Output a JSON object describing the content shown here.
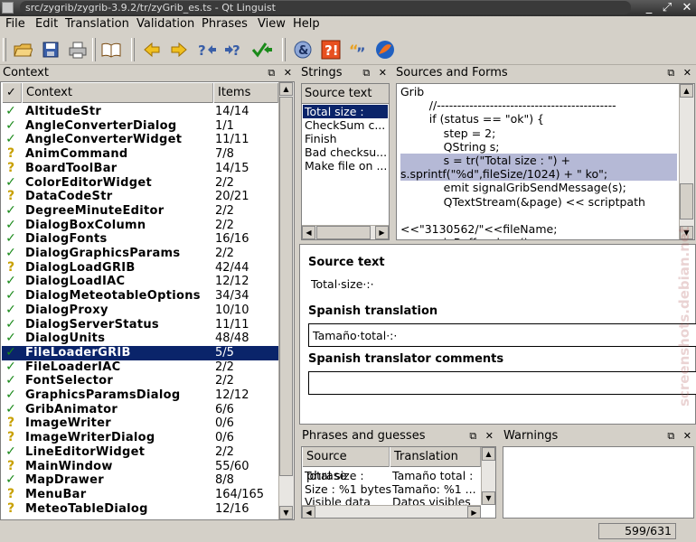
{
  "window": {
    "title": "src/zygrib/zygrib-3.9.2/tr/zyGrib_es.ts - Qt Linguist"
  },
  "menu": [
    "File",
    "Edit",
    "Translation",
    "Validation",
    "Phrases",
    "View",
    "Help"
  ],
  "toolbar": {
    "icons": [
      "open-icon",
      "save-icon",
      "print-icon",
      "phrasebook-icon",
      "prev-icon",
      "next-icon",
      "prev-unfinished-icon",
      "next-unfinished-icon",
      "done-next-icon",
      "accelerators-icon",
      "ending-punctuation-icon",
      "phrase-match-icon",
      "place-marker-icon"
    ]
  },
  "context_pane": {
    "title": "Context",
    "headers": {
      "context": "Context",
      "items": "Items"
    },
    "rows": [
      {
        "status": "ok",
        "name": "AltitudeStr",
        "items": "14/14"
      },
      {
        "status": "ok",
        "name": "AngleConverterDialog",
        "items": "1/1"
      },
      {
        "status": "ok",
        "name": "AngleConverterWidget",
        "items": "11/11"
      },
      {
        "status": "q",
        "name": "AnimCommand",
        "items": "7/8"
      },
      {
        "status": "q",
        "name": "BoardToolBar",
        "items": "14/15"
      },
      {
        "status": "ok",
        "name": "ColorEditorWidget",
        "items": "2/2"
      },
      {
        "status": "q",
        "name": "DataCodeStr",
        "items": "20/21"
      },
      {
        "status": "ok",
        "name": "DegreeMinuteEditor",
        "items": "2/2"
      },
      {
        "status": "ok",
        "name": "DialogBoxColumn",
        "items": "2/2"
      },
      {
        "status": "ok",
        "name": "DialogFonts",
        "items": "16/16"
      },
      {
        "status": "ok",
        "name": "DialogGraphicsParams",
        "items": "2/2"
      },
      {
        "status": "q",
        "name": "DialogLoadGRIB",
        "items": "42/44"
      },
      {
        "status": "ok",
        "name": "DialogLoadIAC",
        "items": "12/12"
      },
      {
        "status": "ok",
        "name": "DialogMeteotableOptions",
        "items": "34/34"
      },
      {
        "status": "ok",
        "name": "DialogProxy",
        "items": "10/10"
      },
      {
        "status": "ok",
        "name": "DialogServerStatus",
        "items": "11/11"
      },
      {
        "status": "ok",
        "name": "DialogUnits",
        "items": "48/48"
      },
      {
        "status": "ok",
        "name": "FileLoaderGRIB",
        "items": "5/5",
        "selected": true
      },
      {
        "status": "ok",
        "name": "FileLoaderIAC",
        "items": "2/2"
      },
      {
        "status": "ok",
        "name": "FontSelector",
        "items": "2/2"
      },
      {
        "status": "ok",
        "name": "GraphicsParamsDialog",
        "items": "12/12"
      },
      {
        "status": "ok",
        "name": "GribAnimator",
        "items": "6/6"
      },
      {
        "status": "q",
        "name": "ImageWriter",
        "items": "0/6"
      },
      {
        "status": "q",
        "name": "ImageWriterDialog",
        "items": "0/6"
      },
      {
        "status": "ok",
        "name": "LineEditorWidget",
        "items": "2/2"
      },
      {
        "status": "q",
        "name": "MainWindow",
        "items": "55/60"
      },
      {
        "status": "ok",
        "name": "MapDrawer",
        "items": "8/8"
      },
      {
        "status": "q",
        "name": "MenuBar",
        "items": "164/165"
      },
      {
        "status": "q",
        "name": "MeteoTableDialog",
        "items": "12/16"
      }
    ]
  },
  "strings_pane": {
    "title": "Strings",
    "header": "Source text",
    "items": [
      "Total size :",
      "CheckSum c...",
      "Finish",
      "Bad checksu...",
      "Make file on ..."
    ]
  },
  "sources_pane": {
    "title": "Sources and Forms",
    "lines": [
      "Grib",
      "        //--------------------------------------------",
      "        if (status == \"ok\") {",
      "            step = 2;",
      "            QString s;",
      "            s = tr(\"Total size : \") +",
      "s.sprintf(\"%d\",fileSize/1024) + \" ko\";",
      "            emit signalGribSendMessage(s);",
      "            QTextStream(&page) << scriptpath",
      "",
      "<<\"3130562/\"<<fileName;",
      "            ioBuffer.close();"
    ],
    "highlight_lines": [
      5,
      6
    ]
  },
  "editor": {
    "source_label": "Source text",
    "source_value": "Total·size·:·",
    "translation_label": "Spanish translation",
    "translation_value": "Tamaño·total·:·",
    "comments_label": "Spanish translator comments",
    "comments_value": ""
  },
  "phrases_pane": {
    "title": "Phrases and guesses",
    "headers": [
      "Source phrase",
      "Translation"
    ],
    "rows": [
      [
        "Total size :",
        "Tamaño total :"
      ],
      [
        "Size : %1 bytes",
        "Tamaño: %1 ..."
      ],
      [
        "Visible data",
        "Datos visibles"
      ]
    ]
  },
  "warnings_pane": {
    "title": "Warnings"
  },
  "status": {
    "count": "599/631"
  },
  "watermark": "screenshots.debian.net"
}
